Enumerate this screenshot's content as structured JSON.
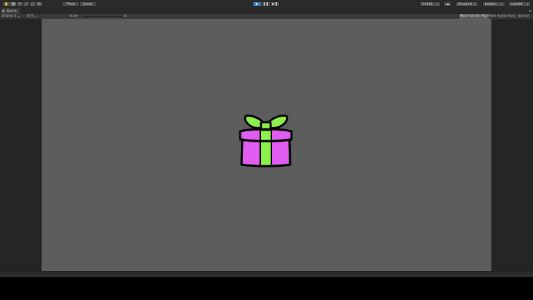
{
  "toolbar": {
    "tools": [
      {
        "name": "hand-tool",
        "glyph": "✋"
      },
      {
        "name": "move-tool",
        "glyph": "✥"
      },
      {
        "name": "rotate-tool",
        "glyph": "⟳"
      },
      {
        "name": "scale-tool",
        "glyph": "⤢"
      },
      {
        "name": "rect-tool",
        "glyph": "▢"
      },
      {
        "name": "transform-tool",
        "glyph": "⊡"
      }
    ],
    "pivot_label": "Pivot",
    "space_label": "Local",
    "play_glyph": "▶",
    "pause_glyph": "❚❚",
    "step_glyph": "▶❚",
    "collab_label": "Collab",
    "cloud_glyph": "☁",
    "account_label": "Account",
    "layers_label": "Layers",
    "layout_label": "Layout"
  },
  "tab": {
    "icon": "game-controller-icon",
    "label": "Game"
  },
  "gamebar": {
    "display": "Display 1",
    "aspect": "16:9",
    "scale_label": "Scale",
    "scale_value": "1x",
    "maximize": "Maximize On Play",
    "mute": "Mute Audio",
    "stats": "Stats",
    "gizmos": "Gizmos"
  },
  "colors": {
    "game_background": "#5d5d5d",
    "gift_box": "#e05df0",
    "gift_ribbon": "#8ef04a",
    "outline": "#000000"
  }
}
